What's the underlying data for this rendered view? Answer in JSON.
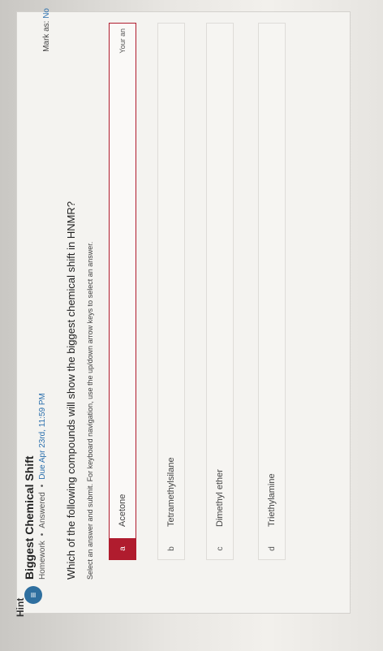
{
  "assignment": {
    "icon": "list-icon",
    "title": "Biggest Chemical Shift",
    "meta": {
      "type": "Homework",
      "status": "Answered",
      "due": "Due Apr 23rd, 11:59 PM"
    },
    "mark_as": {
      "label": "Mark as:",
      "value": "No"
    }
  },
  "question": {
    "text": "Which of the following compounds will show the biggest chemical shift in HNMR?",
    "instruction": "Select an answer and submit. For keyboard navigation, use the up/down arrow keys to select an answer.",
    "options": [
      {
        "letter": "a",
        "label": "Acetone",
        "selected": true,
        "note": "Your an"
      },
      {
        "letter": "b",
        "label": "Tetramethylsilane"
      },
      {
        "letter": "c",
        "label": "Dimethyl ether"
      },
      {
        "letter": "d",
        "label": "Triethylamine"
      }
    ]
  },
  "hint": {
    "label": "Hint"
  },
  "colors": {
    "accent": "#b01c2e",
    "link": "#2a6fad",
    "badge": "#2f6f9f"
  }
}
